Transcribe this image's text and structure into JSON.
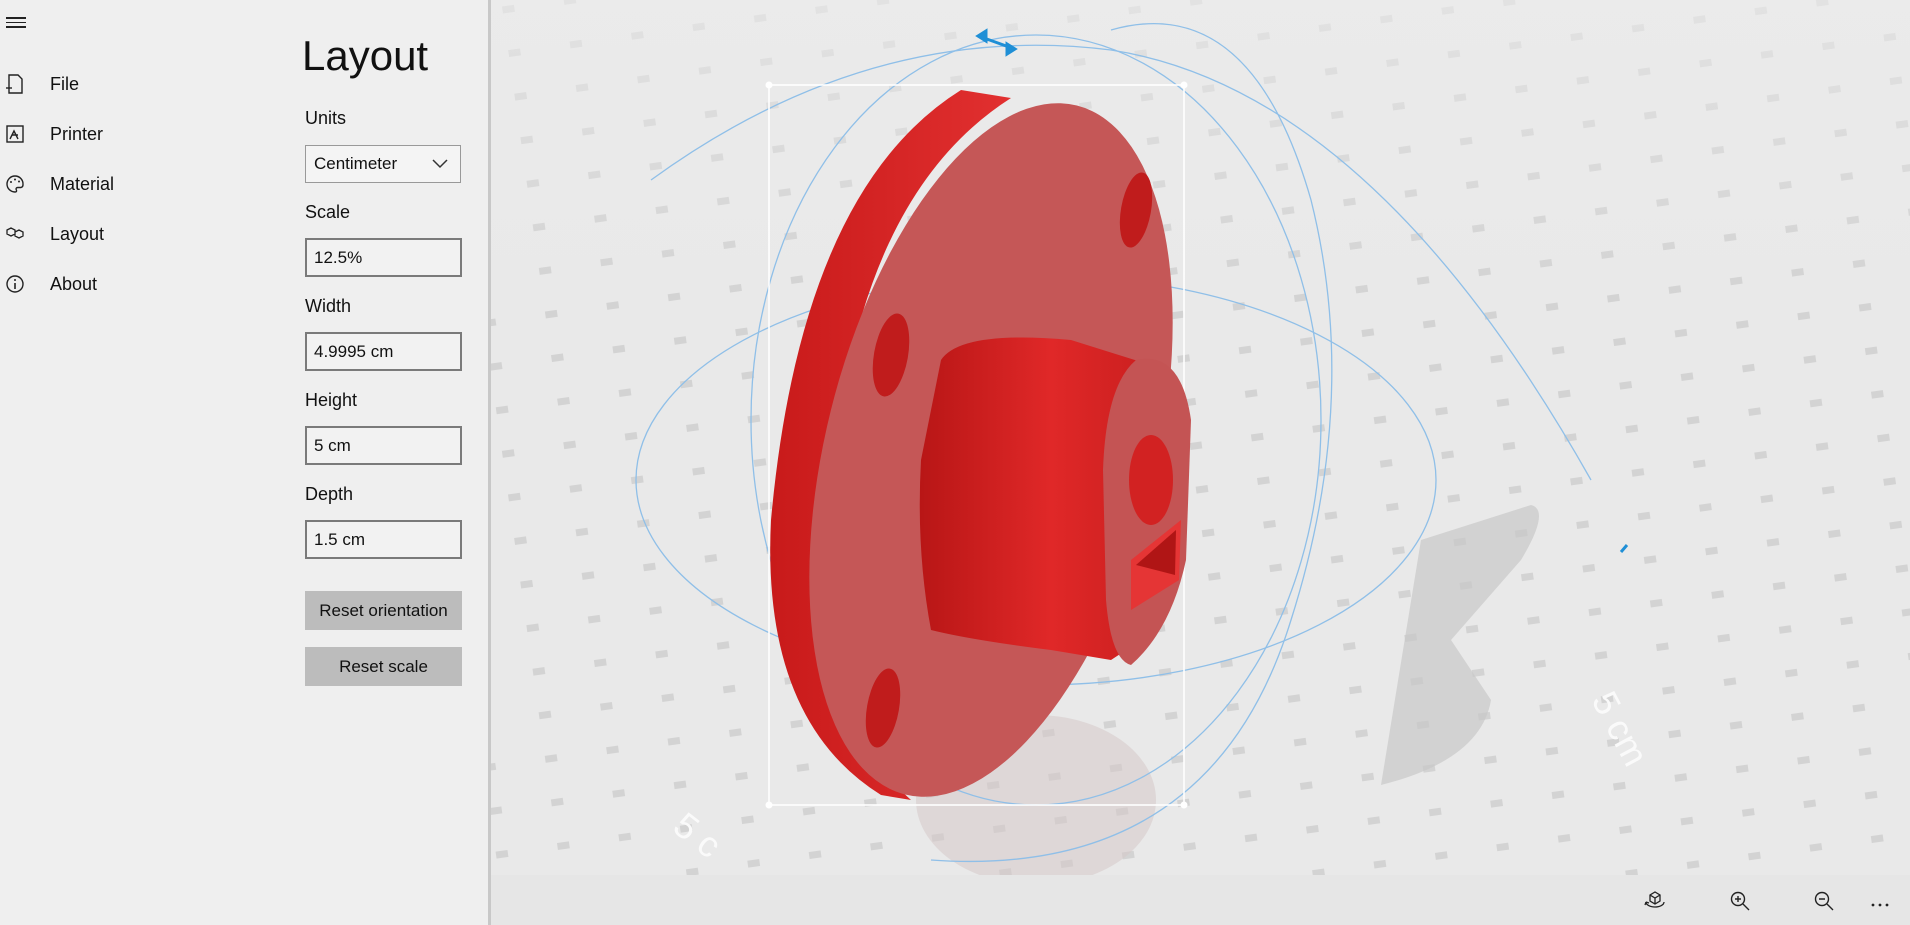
{
  "nav": {
    "items": [
      {
        "label": "File",
        "icon": "file-icon"
      },
      {
        "label": "Printer",
        "icon": "printer-icon"
      },
      {
        "label": "Material",
        "icon": "palette-icon"
      },
      {
        "label": "Layout",
        "icon": "layout-cubes-icon"
      },
      {
        "label": "About",
        "icon": "info-icon"
      }
    ]
  },
  "panel": {
    "title": "Layout",
    "units_label": "Units",
    "units_value": "Centimeter",
    "scale_label": "Scale",
    "scale_value": "12.5%",
    "width_label": "Width",
    "width_value": "4.9995 cm",
    "height_label": "Height",
    "height_value": "5 cm",
    "depth_label": "Depth",
    "depth_value": "1.5 cm",
    "reset_orientation_label": "Reset orientation",
    "reset_scale_label": "Reset scale"
  },
  "viewport": {
    "dimension_label_right": "5 cm",
    "dimension_label_bottom": "5 c",
    "model_color": "#d42323",
    "gizmo_color": "#8fbfe8",
    "handle_color": "#1f8fd6"
  },
  "toolbar": {
    "buttons": [
      "reset-view-icon",
      "zoom-in-icon",
      "zoom-out-icon",
      "more-options-icon"
    ]
  }
}
